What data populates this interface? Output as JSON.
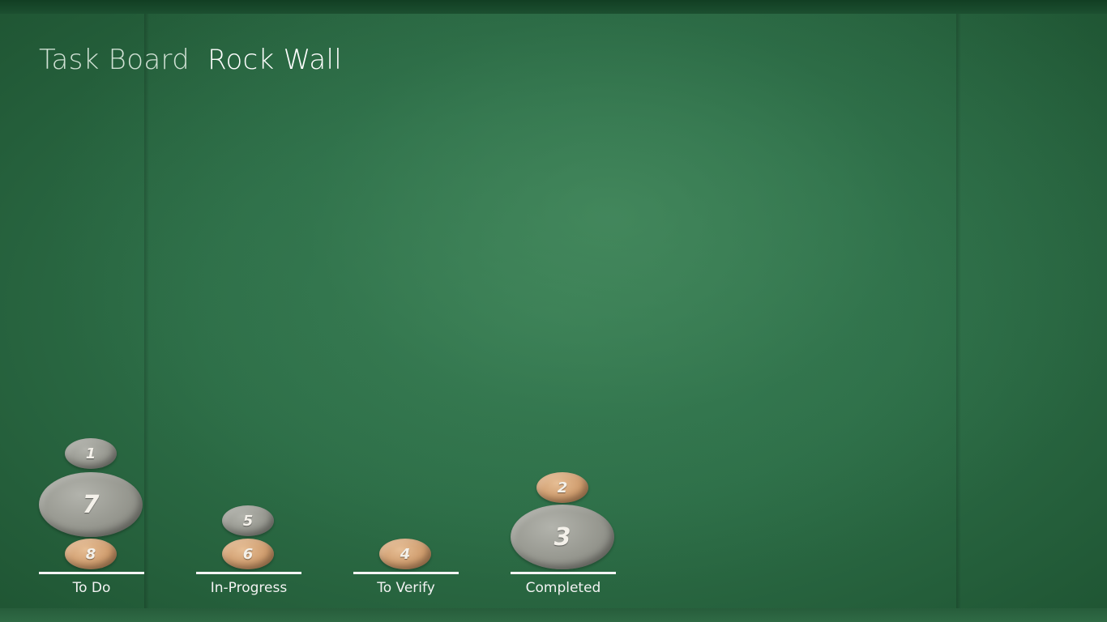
{
  "header": {
    "app_title": "Task Board",
    "page_title": "Rock Wall"
  },
  "lanes": [
    {
      "label": "To Do",
      "rocks": [
        {
          "number": "1",
          "size": "small",
          "color": "grey"
        },
        {
          "number": "7",
          "size": "large",
          "color": "grey"
        },
        {
          "number": "8",
          "size": "small",
          "color": "tan"
        }
      ]
    },
    {
      "label": "In-Progress",
      "rocks": [
        {
          "number": "5",
          "size": "small",
          "color": "grey"
        },
        {
          "number": "6",
          "size": "small",
          "color": "tan"
        }
      ]
    },
    {
      "label": "To Verify",
      "rocks": [
        {
          "number": "4",
          "size": "small",
          "color": "tan"
        }
      ]
    },
    {
      "label": "Completed",
      "rocks": [
        {
          "number": "2",
          "size": "small",
          "color": "tan"
        },
        {
          "number": "3",
          "size": "large",
          "color": "grey"
        }
      ]
    }
  ],
  "colors": {
    "board_green": "#2d6e47",
    "rock_grey": "#96978f",
    "rock_tan": "#cf9c6d",
    "shelf": "#f4f4f4"
  }
}
